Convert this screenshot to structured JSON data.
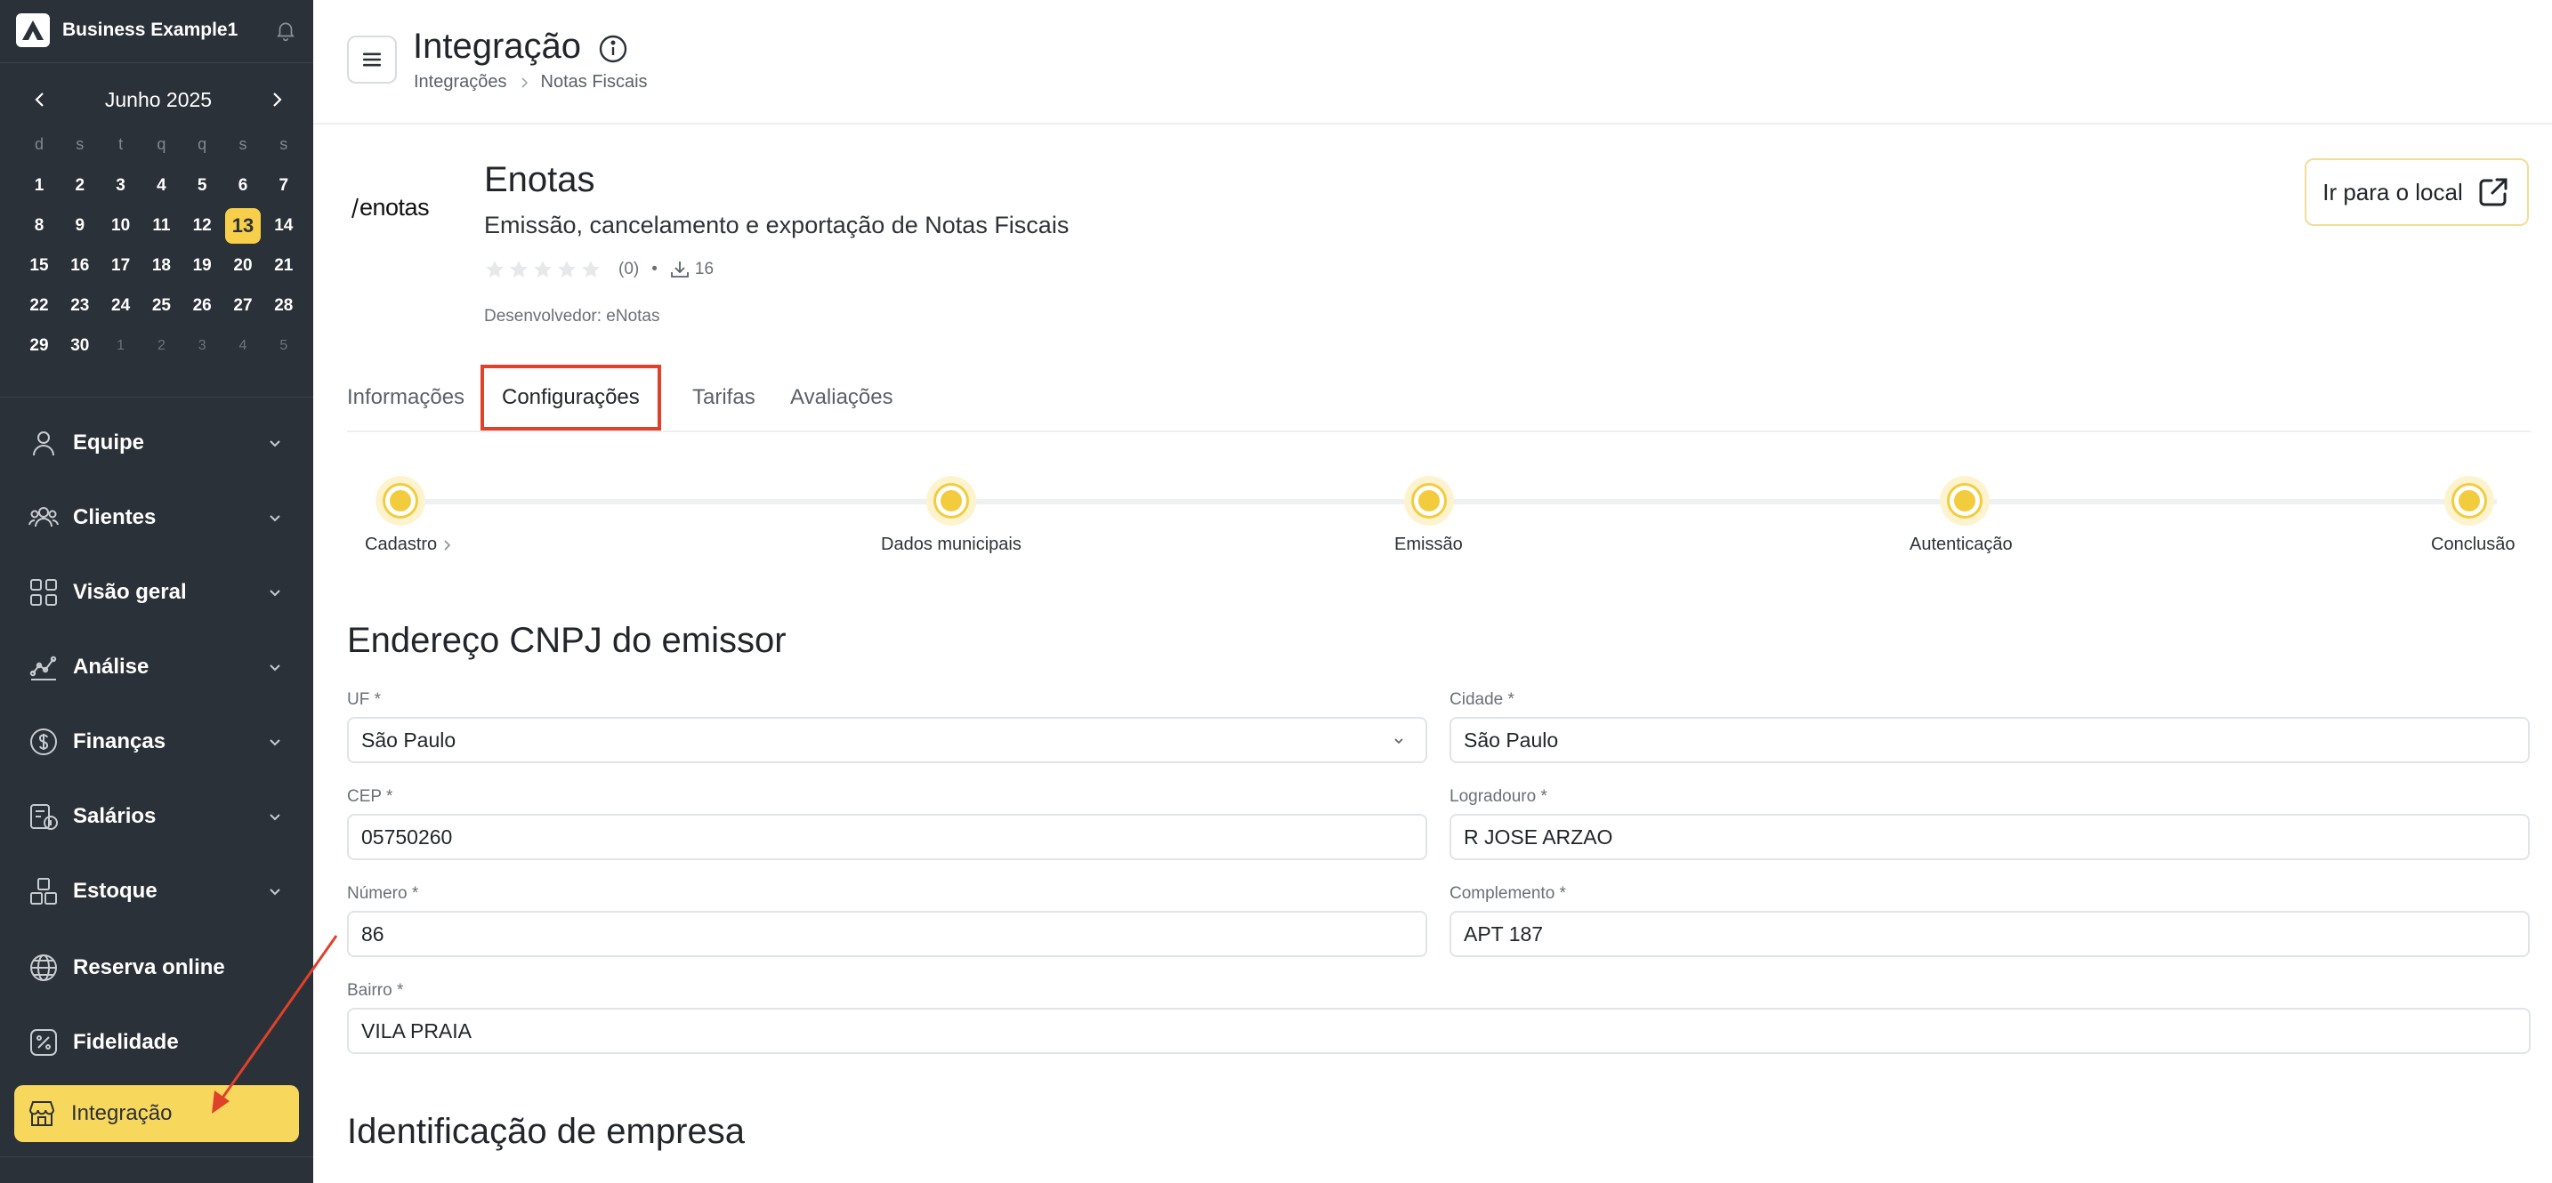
{
  "sidebar": {
    "business_name": "Business Example1",
    "calendar": {
      "month_label": "Junho 2025",
      "weekdays": [
        "d",
        "s",
        "t",
        "q",
        "q",
        "s",
        "s"
      ],
      "days": [
        {
          "d": "1",
          "muted": false
        },
        {
          "d": "2",
          "muted": false
        },
        {
          "d": "3",
          "muted": false
        },
        {
          "d": "4",
          "muted": false
        },
        {
          "d": "5",
          "muted": false
        },
        {
          "d": "6",
          "muted": false
        },
        {
          "d": "7",
          "muted": false
        },
        {
          "d": "8",
          "muted": false
        },
        {
          "d": "9",
          "muted": false
        },
        {
          "d": "10",
          "muted": false
        },
        {
          "d": "11",
          "muted": false
        },
        {
          "d": "12",
          "muted": false
        },
        {
          "d": "13",
          "muted": false,
          "today": true
        },
        {
          "d": "14",
          "muted": false
        },
        {
          "d": "15",
          "muted": false
        },
        {
          "d": "16",
          "muted": false
        },
        {
          "d": "17",
          "muted": false
        },
        {
          "d": "18",
          "muted": false
        },
        {
          "d": "19",
          "muted": false
        },
        {
          "d": "20",
          "muted": false
        },
        {
          "d": "21",
          "muted": false
        },
        {
          "d": "22",
          "muted": false
        },
        {
          "d": "23",
          "muted": false
        },
        {
          "d": "24",
          "muted": false
        },
        {
          "d": "25",
          "muted": false
        },
        {
          "d": "26",
          "muted": false
        },
        {
          "d": "27",
          "muted": false
        },
        {
          "d": "28",
          "muted": false
        },
        {
          "d": "29",
          "muted": false
        },
        {
          "d": "30",
          "muted": false
        },
        {
          "d": "1",
          "muted": true
        },
        {
          "d": "2",
          "muted": true
        },
        {
          "d": "3",
          "muted": true
        },
        {
          "d": "4",
          "muted": true
        },
        {
          "d": "5",
          "muted": true
        }
      ]
    },
    "nav": [
      {
        "label": "Equipe",
        "icon": "user-icon",
        "has_chevron": true
      },
      {
        "label": "Clientes",
        "icon": "users-icon",
        "has_chevron": true
      },
      {
        "label": "Visão geral",
        "icon": "grid-icon",
        "has_chevron": true
      },
      {
        "label": "Análise",
        "icon": "analytics-icon",
        "has_chevron": true
      },
      {
        "label": "Finanças",
        "icon": "dollar-icon",
        "has_chevron": true
      },
      {
        "label": "Salários",
        "icon": "payroll-icon",
        "has_chevron": true
      },
      {
        "label": "Estoque",
        "icon": "boxes-icon",
        "has_chevron": true
      },
      {
        "label": "Reserva online",
        "icon": "globe-icon",
        "has_chevron": false
      },
      {
        "label": "Fidelidade",
        "icon": "percent-icon",
        "has_chevron": false
      },
      {
        "label": "Integração",
        "icon": "store-icon",
        "has_chevron": false,
        "active": true
      }
    ]
  },
  "header": {
    "title": "Integração",
    "breadcrumb": [
      "Integrações",
      "Notas Fiscais"
    ]
  },
  "app": {
    "logo_text": "enotas",
    "name": "Enotas",
    "description": "Emissão, cancelamento e exportação de Notas Fiscais",
    "rating_count": "(0)",
    "separator": "•",
    "downloads": "16",
    "developer": "Desenvolvedor: eNotas",
    "goto_button": "Ir para o local"
  },
  "tabs": [
    {
      "label": "Informações",
      "selected": false
    },
    {
      "label": "Configurações",
      "selected": true
    },
    {
      "label": "Tarifas",
      "selected": false
    },
    {
      "label": "Avaliações",
      "selected": false
    }
  ],
  "steps": [
    "Cadastro",
    "Dados municipais",
    "Emissão",
    "Autenticação",
    "Conclusão"
  ],
  "address_section": {
    "title": "Endereço CNPJ do emissor",
    "fields": {
      "uf": {
        "label": "UF *",
        "value": "São Paulo"
      },
      "cidade": {
        "label": "Cidade *",
        "value": "São Paulo"
      },
      "cep": {
        "label": "CEP *",
        "value": "05750260"
      },
      "logradouro": {
        "label": "Logradouro *",
        "value": "R JOSE ARZAO"
      },
      "numero": {
        "label": "Número *",
        "value": "86"
      },
      "complemento": {
        "label": "Complemento *",
        "value": "APT 187"
      },
      "bairro": {
        "label": "Bairro *",
        "value": "VILA PRAIA"
      }
    }
  },
  "company_section": {
    "title": "Identificação de empresa"
  },
  "colors": {
    "accent": "#f7d75c",
    "sidebar_bg": "#2b3138",
    "annotation": "#e0412a"
  }
}
